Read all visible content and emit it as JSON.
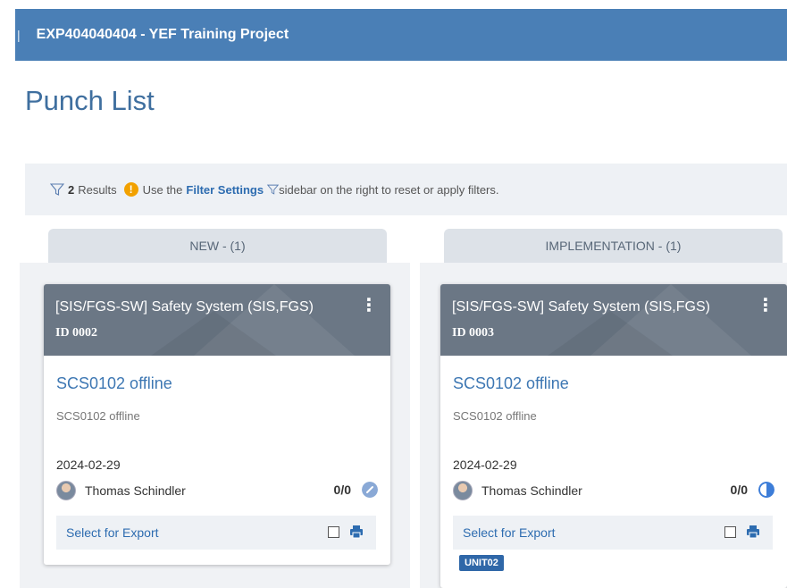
{
  "header": {
    "separator": "|",
    "project": "EXP404040404 - YEF Training Project"
  },
  "page": {
    "title": "Punch List"
  },
  "filter": {
    "count": "2",
    "results_label": "Results",
    "hint_pre": "Use the",
    "link": "Filter Settings",
    "hint_post": "sidebar on the right to reset or apply filters."
  },
  "columns": [
    {
      "label": "NEW - (1)"
    },
    {
      "label": "IMPLEMENTATION - (1)"
    }
  ],
  "cards": [
    {
      "system": "[SIS/FGS-SW] Safety System (SIS,FGS)",
      "id": "ID 0002",
      "kebab": "⋮",
      "title": "SCS0102 offline",
      "description": "SCS0102 offline",
      "date": "2024-02-29",
      "user": "Thomas Schindler",
      "ratio": "0/0",
      "export_label": "Select for Export",
      "status_icon": "status-new-icon"
    },
    {
      "system": "[SIS/FGS-SW] Safety System (SIS,FGS)",
      "id": "ID 0003",
      "kebab": "⋮",
      "title": "SCS0102 offline",
      "description": "SCS0102 offline",
      "date": "2024-02-29",
      "user": "Thomas Schindler",
      "ratio": "0/0",
      "export_label": "Select for Export",
      "status_icon": "status-half-icon",
      "badge": "UNIT02"
    }
  ],
  "colors": {
    "header": "#4a7fb6",
    "card_header": "#6b7785",
    "link": "#2d6cb0",
    "badge": "#2f67a8",
    "warning": "#f2a100"
  }
}
